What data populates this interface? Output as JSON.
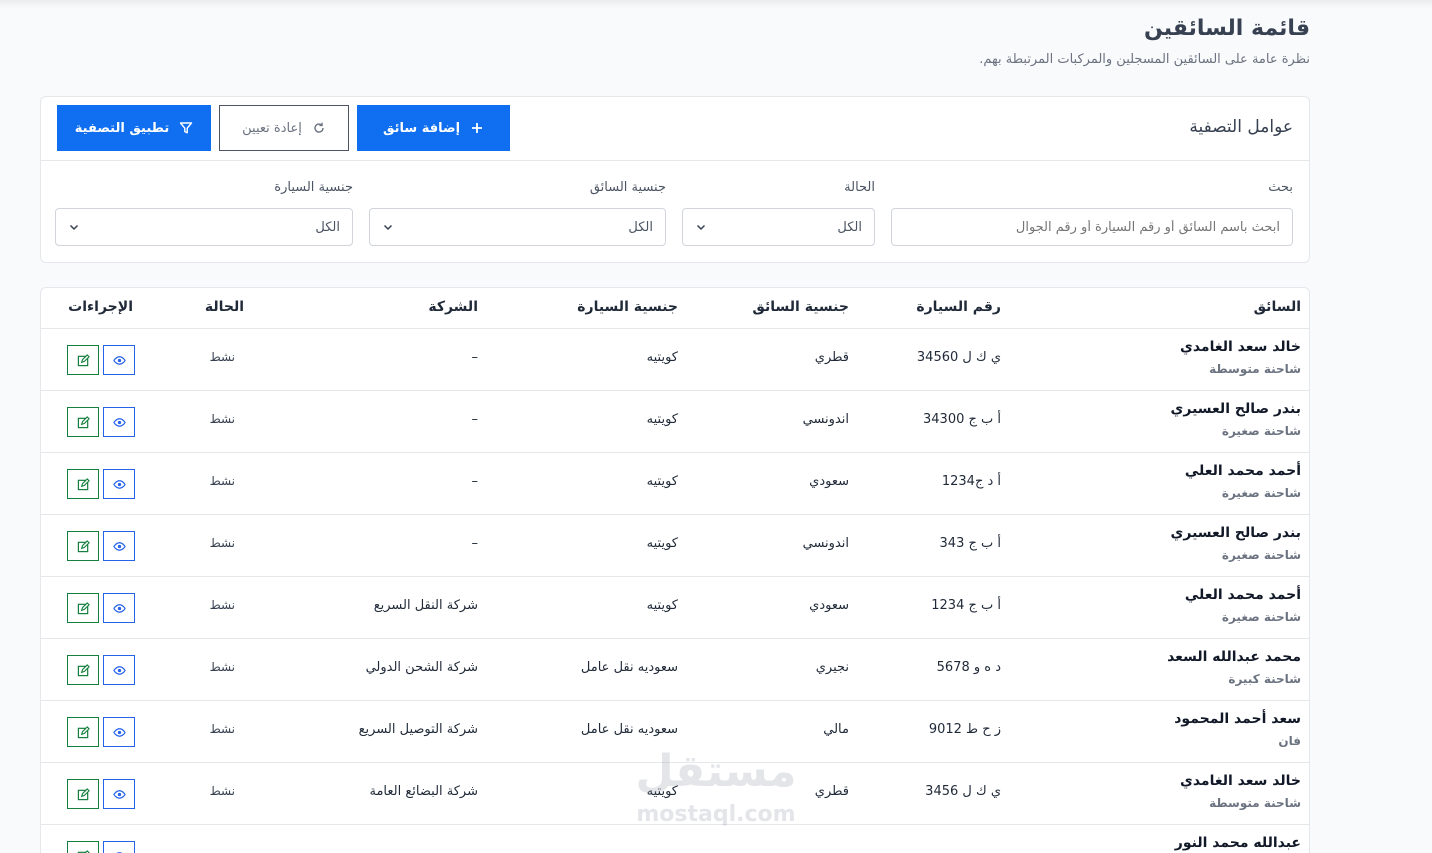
{
  "page": {
    "title": "قائمة السائقين",
    "subtitle": "نظرة عامة على السائقين المسجلين والمركبات المرتبطة بهم."
  },
  "filters": {
    "title": "عوامل التصفية",
    "add_driver": "إضافة سائق",
    "reset": "إعادة تعيين",
    "apply": "تطبيق التصفية",
    "search_label": "بحث",
    "search_placeholder": "ابحث باسم السائق أو رقم السيارة أو رقم الجوال",
    "status_label": "الحالة",
    "status_value": "الكل",
    "driver_nat_label": "جنسية السائق",
    "driver_nat_value": "الكل",
    "car_nat_label": "جنسية السيارة",
    "car_nat_value": "الكل"
  },
  "table": {
    "headers": {
      "driver": "السائق",
      "plate": "رقم السيارة",
      "driver_nat": "جنسية السائق",
      "car_nat": "جنسية السيارة",
      "company": "الشركة",
      "status": "الحالة",
      "actions": "الإجراءات"
    },
    "rows": [
      {
        "name": "خالد سعد الغامدي",
        "type": "شاحنة متوسطة",
        "plate": "ي ك ل 34560",
        "driver_nat": "قطري",
        "car_nat": "كويتيه",
        "company": "–",
        "status": "نشط"
      },
      {
        "name": "بندر صالح العسيري",
        "type": "شاحنة صغيرة",
        "plate": "أ ب ج 34300",
        "driver_nat": "اندونسي",
        "car_nat": "كويتيه",
        "company": "–",
        "status": "نشط"
      },
      {
        "name": "أحمد محمد العلي",
        "type": "شاحنة صغيرة",
        "plate": "أ د ج1234",
        "driver_nat": "سعودي",
        "car_nat": "كويتيه",
        "company": "–",
        "status": "نشط"
      },
      {
        "name": "بندر صالح العسيري",
        "type": "شاحنة صغيرة",
        "plate": "أ ب ج 343",
        "driver_nat": "اندونسي",
        "car_nat": "كويتيه",
        "company": "–",
        "status": "نشط"
      },
      {
        "name": "أحمد محمد العلي",
        "type": "شاحنة صغيرة",
        "plate": "أ ب ج 1234",
        "driver_nat": "سعودي",
        "car_nat": "كويتيه",
        "company": "شركة النقل السريع",
        "status": "نشط"
      },
      {
        "name": "محمد عبدالله السعد",
        "type": "شاحنة كبيرة",
        "plate": "د ه و 5678",
        "driver_nat": "نجيري",
        "car_nat": "سعوديه نقل عامل",
        "company": "شركة الشحن الدولي",
        "status": "نشط"
      },
      {
        "name": "سعد أحمد المحمود",
        "type": "فان",
        "plate": "ز ح ط 9012",
        "driver_nat": "مالي",
        "car_nat": "سعوديه نقل عامل",
        "company": "شركة التوصيل السريع",
        "status": "نشط"
      },
      {
        "name": "خالد سعد الغامدي",
        "type": "شاحنة متوسطة",
        "plate": "ي ك ل 3456",
        "driver_nat": "قطري",
        "car_nat": "كويتيه",
        "company": "شركة البضائع العامة",
        "status": "نشط"
      },
      {
        "name": "عبدالله محمد النور",
        "type": "",
        "plate": "",
        "driver_nat": "",
        "car_nat": "",
        "company": "",
        "status": ""
      }
    ]
  },
  "watermark": {
    "arabic": "مستقل",
    "latin": "mostaql.com"
  },
  "colors": {
    "primary": "#0f6ff0",
    "view": "#2563eb",
    "edit": "#15803d"
  }
}
